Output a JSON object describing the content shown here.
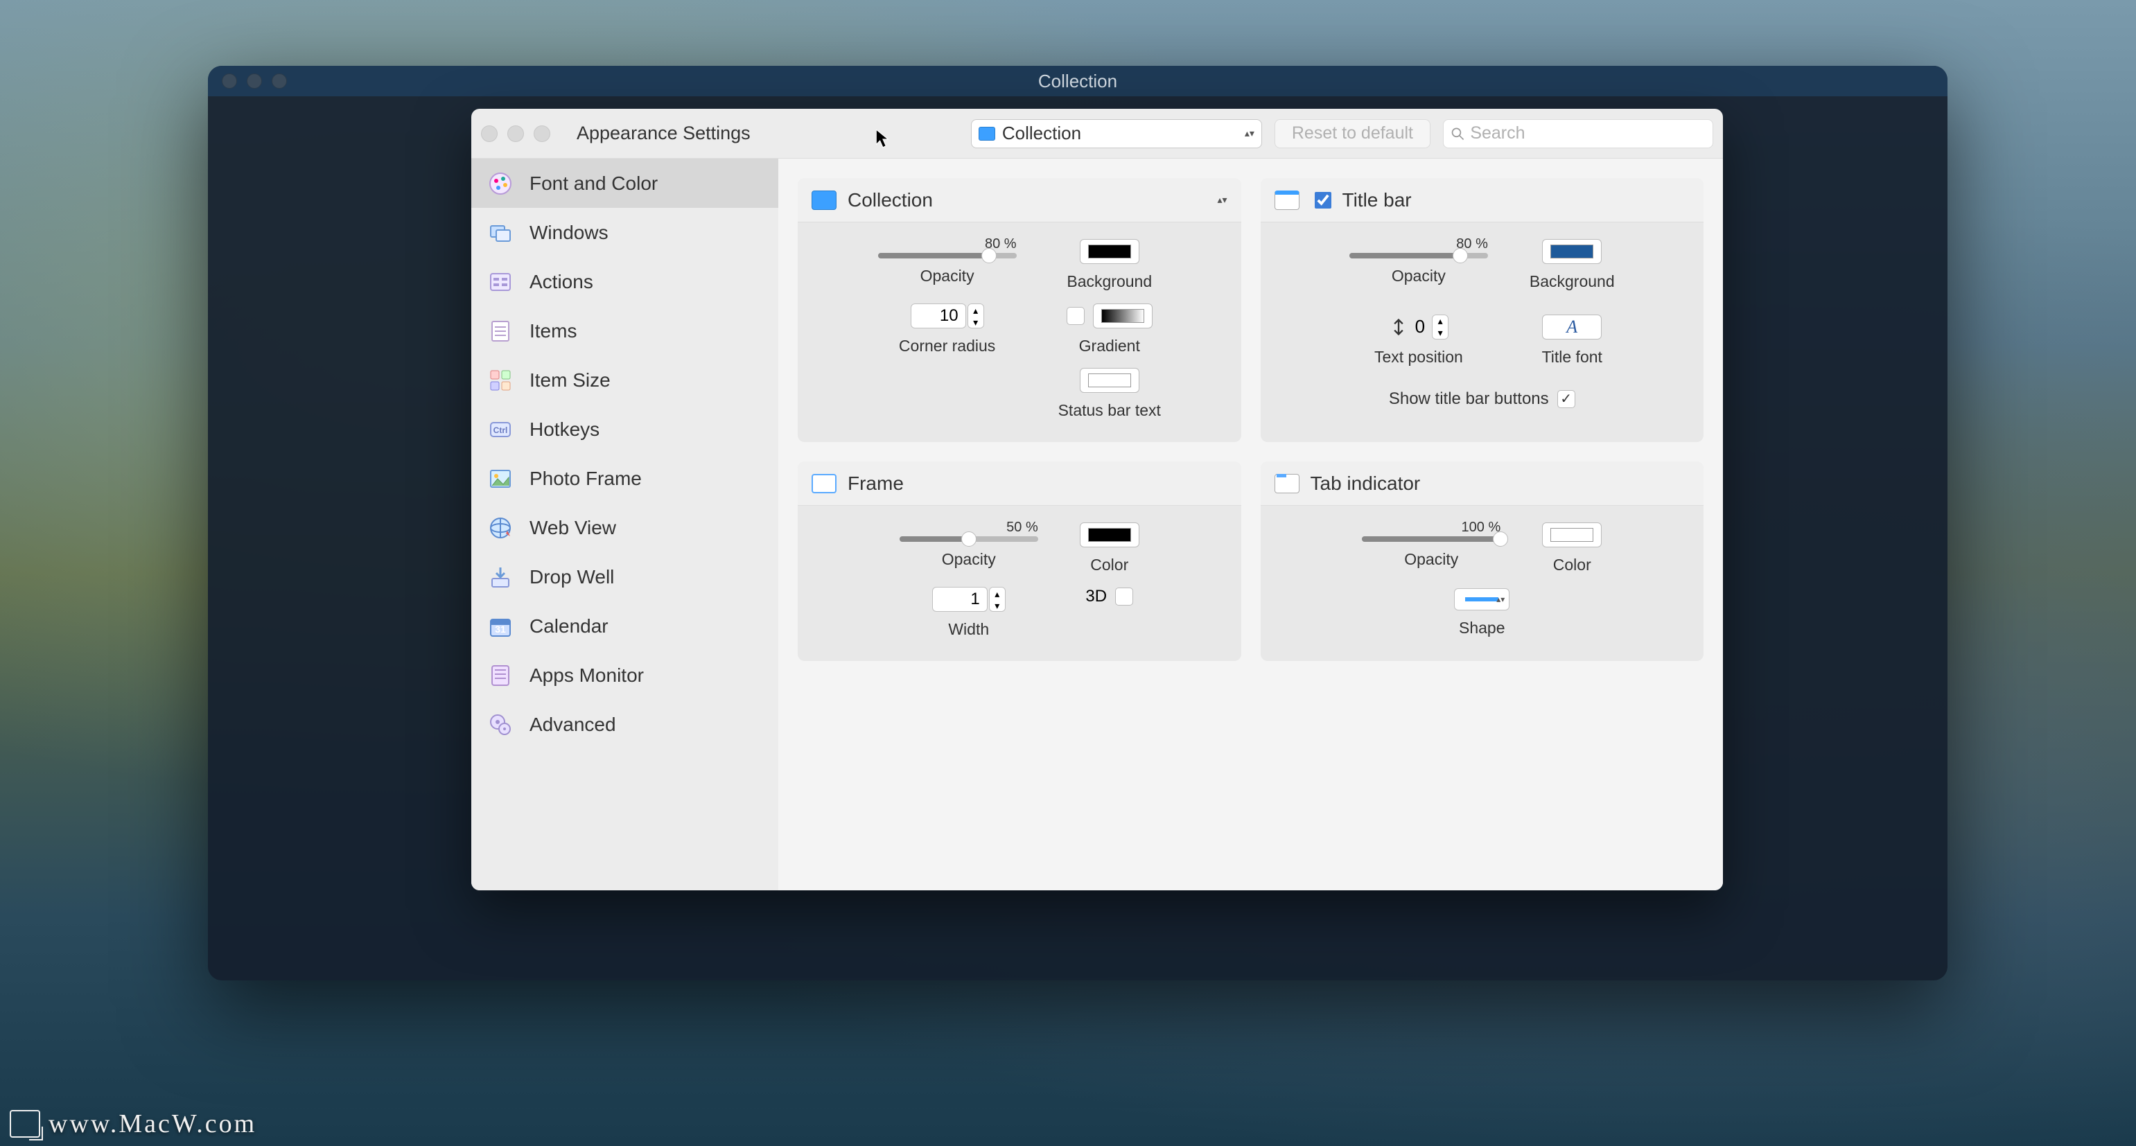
{
  "outer_window": {
    "title": "Collection"
  },
  "toolbar": {
    "title": "Appearance Settings",
    "dropdown_value": "Collection",
    "reset_label": "Reset to default",
    "search_placeholder": "Search"
  },
  "sidebar": {
    "items": [
      {
        "label": "Font and Color"
      },
      {
        "label": "Windows"
      },
      {
        "label": "Actions"
      },
      {
        "label": "Items"
      },
      {
        "label": "Item Size"
      },
      {
        "label": "Hotkeys"
      },
      {
        "label": "Photo Frame"
      },
      {
        "label": "Web View"
      },
      {
        "label": "Drop Well"
      },
      {
        "label": "Calendar"
      },
      {
        "label": "Apps Monitor"
      },
      {
        "label": "Advanced"
      }
    ],
    "selected_index": 0
  },
  "panels": {
    "collection": {
      "title": "Collection",
      "opacity_pct": "80 %",
      "opacity_value": 80,
      "background_color": "#000000",
      "corner_radius": "10",
      "gradient_checked": false,
      "gradient_swatch_from": "#000000",
      "gradient_swatch_to": "#ffffff",
      "statusbar_swatch": "#ffffff",
      "labels": {
        "opacity": "Opacity",
        "background": "Background",
        "corner_radius": "Corner radius",
        "gradient": "Gradient",
        "statusbar": "Status bar text"
      }
    },
    "titlebar": {
      "title": "Title bar",
      "enabled": true,
      "opacity_pct": "80 %",
      "opacity_value": 80,
      "background_color": "#1e5a9a",
      "text_position": "0",
      "title_font_glyph": "A",
      "show_buttons_label": "Show title bar buttons",
      "show_buttons_checked": true,
      "labels": {
        "opacity": "Opacity",
        "background": "Background",
        "text_position": "Text position",
        "title_font": "Title font"
      }
    },
    "frame": {
      "title": "Frame",
      "opacity_pct": "50 %",
      "opacity_value": 50,
      "color": "#000000",
      "width": "1",
      "threeD_label": "3D",
      "threeD_checked": false,
      "labels": {
        "opacity": "Opacity",
        "color": "Color",
        "width": "Width"
      }
    },
    "tab": {
      "title": "Tab indicator",
      "opacity_pct": "100 %",
      "opacity_value": 100,
      "color": "#ffffff",
      "labels": {
        "opacity": "Opacity",
        "color": "Color",
        "shape": "Shape"
      }
    }
  },
  "watermark": "www.MacW.com"
}
